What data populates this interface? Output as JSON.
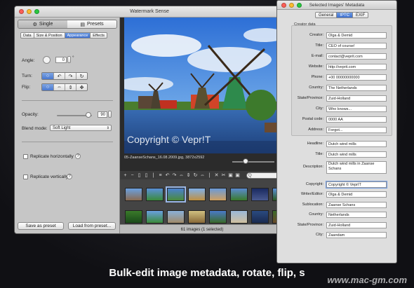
{
  "main_window": {
    "title": "Watermark Sense",
    "mode_tabs": [
      {
        "label": "Single",
        "icon": "gear-icon",
        "selected": true
      },
      {
        "label": "Presets",
        "icon": "list-icon",
        "selected": false
      }
    ],
    "sub_tabs": [
      {
        "label": "Data",
        "selected": false
      },
      {
        "label": "Size & Position",
        "selected": false
      },
      {
        "label": "Appearance",
        "selected": true
      },
      {
        "label": "Effects",
        "selected": false
      }
    ],
    "angle_label": "Angle:",
    "angle_value": "0",
    "angle_unit": "°",
    "turn_label": "Turn:",
    "turn_buttons": [
      "○",
      "↶",
      "↷",
      "↻"
    ],
    "flip_label": "Flip:",
    "flip_buttons": [
      "○",
      "⇔",
      "⇕",
      "✥"
    ],
    "opacity_label": "Opacity:",
    "opacity_value": "90",
    "opacity_fraction": 0.9,
    "blend_label": "Blend mode:",
    "blend_value": "Soft Light",
    "replicate_h_label": "Replicate horizontally",
    "replicate_v_label": "Replicate vertically",
    "help_glyph": "?",
    "save_preset_label": "Save as preset",
    "load_preset_label": "Load from preset...",
    "watermark_text": "Copyright © Vepr!T",
    "file_info": "05-ZaanseSchans_16.08.2009.jpg, 3872x2592",
    "toolbar_icons": [
      "+",
      "−",
      "▯",
      "▯",
      "|",
      "≡",
      "↶",
      "↷",
      "⇔",
      "⇕",
      "↻",
      "⇔",
      "|",
      "✕",
      "✂",
      "▣",
      "▣"
    ],
    "search_glyph": "Q",
    "status_text": "61 images (1 selected)"
  },
  "meta_window": {
    "title": "Selected Images' Metadata",
    "tabs": [
      {
        "label": "General",
        "selected": false
      },
      {
        "label": "IPTC",
        "selected": true
      },
      {
        "label": "EXIF",
        "selected": false
      }
    ],
    "group_title": "Creator data",
    "creator_fields": [
      {
        "label": "Creator:",
        "value": "Olga & Demid"
      },
      {
        "label": "Title:",
        "value": "CEO of course!"
      },
      {
        "label": "E-mail:",
        "value": "contact@veprit.com"
      },
      {
        "label": "Website:",
        "value": "http://veprit.com"
      },
      {
        "label": "Phone:",
        "value": "+00 00000000000"
      },
      {
        "label": "Country:",
        "value": "The Netherlands"
      },
      {
        "label": "State/Province:",
        "value": "Zuid-Holland"
      },
      {
        "label": "City:",
        "value": "Who knows..."
      },
      {
        "label": "Postal code:",
        "value": "0000 AA"
      },
      {
        "label": "Address:",
        "value": "Forgot..."
      }
    ],
    "content_fields": [
      {
        "label": "Headline:",
        "value": "Dutch wind mills"
      },
      {
        "label": "Title:",
        "value": "Dutch wind mills"
      },
      {
        "label": "Description:",
        "value": "Dutch wind mills in Zaanse Schans"
      },
      {
        "label": "Copyright:",
        "value": "Copyright © VeprIT"
      },
      {
        "label": "Writer/Editor:",
        "value": "Olga & Demid"
      },
      {
        "label": "Sublocation:",
        "value": "Zaanse Schans"
      },
      {
        "label": "Country:",
        "value": "Netherlands"
      },
      {
        "label": "State/Province:",
        "value": "Zuid-Holland"
      },
      {
        "label": "City:",
        "value": "Zaandam"
      }
    ]
  },
  "caption": "Bulk-edit image metadata, rotate, flip, s",
  "site_watermark": "www.mac-gm.com"
}
